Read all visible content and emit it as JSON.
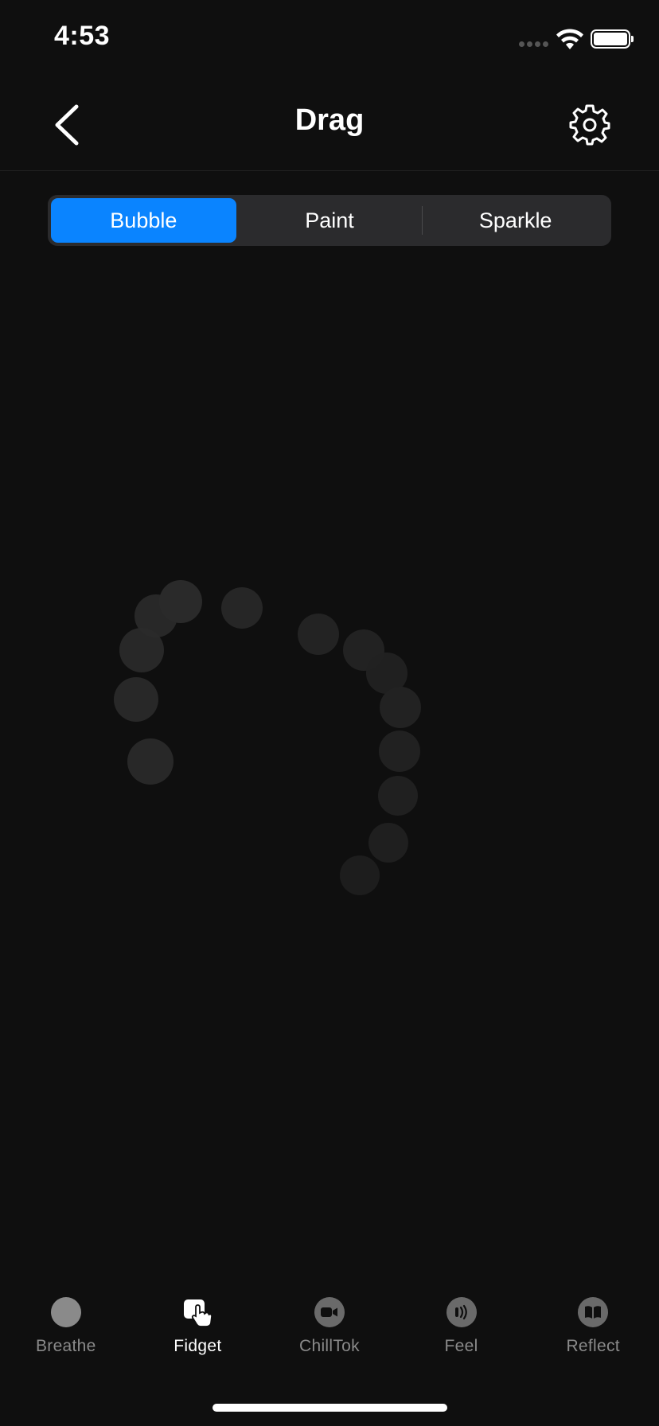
{
  "status_bar": {
    "time": "4:53"
  },
  "nav": {
    "title": "Drag",
    "back_icon": "chevron-left-icon",
    "settings_icon": "gear-icon"
  },
  "segmented": {
    "options": [
      "Bubble",
      "Paint",
      "Sparkle"
    ],
    "selected": "Bubble"
  },
  "tabs": [
    {
      "label": "Breathe",
      "icon": "circle-icon",
      "active": false
    },
    {
      "label": "Fidget",
      "icon": "hand-tap-icon",
      "active": true
    },
    {
      "label": "ChillTok",
      "icon": "video-camera-icon",
      "active": false
    },
    {
      "label": "Feel",
      "icon": "vibration-icon",
      "active": false
    },
    {
      "label": "Reflect",
      "icon": "book-icon",
      "active": false
    }
  ],
  "colors": {
    "background": "#0f0f0f",
    "accent": "#0a84ff",
    "segment_bg": "#2b2b2d",
    "bubble": "#2a2a2a",
    "inactive_tab": "#8a8a8a"
  }
}
